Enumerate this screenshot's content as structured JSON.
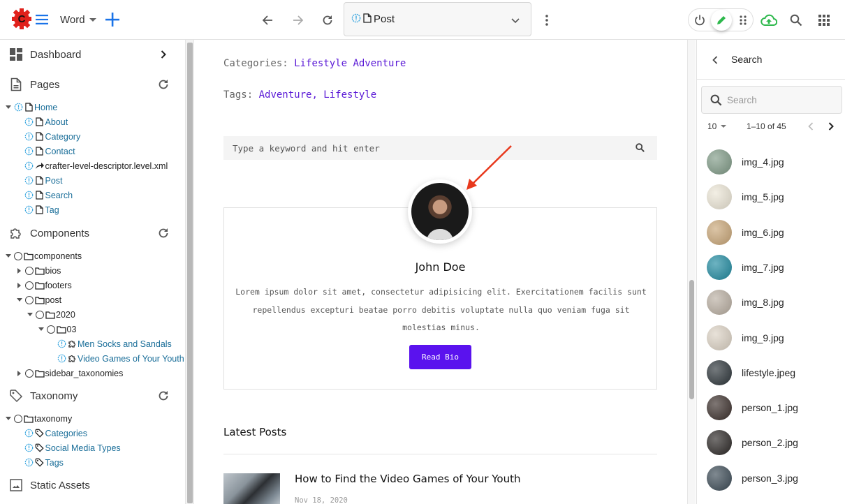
{
  "toolbar": {
    "site_name": "Word",
    "address_label": "Post",
    "icons": {
      "logo": "crafter-logo-icon",
      "menu": "hamburger-menu-icon",
      "add": "plus-icon",
      "back": "arrow-left-icon",
      "forward": "arrow-right-icon",
      "reload": "refresh-icon",
      "more": "more-vertical-icon",
      "preview_mode": "power-icon",
      "edit_mode": "pencil-icon",
      "move_mode": "drag-handle-icon",
      "publish": "cloud-upload-icon",
      "search": "search-icon",
      "apps": "apps-grid-icon"
    },
    "colors": {
      "brand_red": "#e0211b",
      "accent_blue": "#1a73e8",
      "edit_green": "#2db84c"
    }
  },
  "sidebar": {
    "dashboard": {
      "label": "Dashboard"
    },
    "pages": {
      "label": "Pages",
      "tree": [
        {
          "label": "Home",
          "level": 0,
          "expanded": true,
          "type": "page",
          "link": true
        },
        {
          "label": "About",
          "level": 1,
          "type": "page",
          "link": true
        },
        {
          "label": "Category",
          "level": 1,
          "type": "page",
          "link": true
        },
        {
          "label": "Contact",
          "level": 1,
          "type": "page",
          "link": true
        },
        {
          "label": "crafter-level-descriptor.level.xml",
          "level": 1,
          "type": "level-descriptor",
          "link": false
        },
        {
          "label": "Post",
          "level": 1,
          "type": "page",
          "link": true
        },
        {
          "label": "Search",
          "level": 1,
          "type": "page",
          "link": true
        },
        {
          "label": "Tag",
          "level": 1,
          "type": "page",
          "link": true
        }
      ]
    },
    "components": {
      "label": "Components",
      "tree": [
        {
          "label": "components",
          "level": 0,
          "expanded": true,
          "type": "folder"
        },
        {
          "label": "bios",
          "level": 1,
          "expanded": false,
          "type": "folder"
        },
        {
          "label": "footers",
          "level": 1,
          "expanded": false,
          "type": "folder"
        },
        {
          "label": "post",
          "level": 1,
          "expanded": true,
          "type": "folder"
        },
        {
          "label": "2020",
          "level": 2,
          "expanded": true,
          "type": "folder"
        },
        {
          "label": "03",
          "level": 3,
          "expanded": true,
          "type": "folder"
        },
        {
          "label": "Men Socks and Sandals",
          "level": 4,
          "type": "component",
          "link": true
        },
        {
          "label": "Video Games of Your Youth",
          "level": 4,
          "type": "component",
          "link": true
        },
        {
          "label": "sidebar_taxonomies",
          "level": 1,
          "expanded": false,
          "type": "folder"
        }
      ]
    },
    "taxonomy": {
      "label": "Taxonomy",
      "tree": [
        {
          "label": "taxonomy",
          "level": 0,
          "expanded": true,
          "type": "folder"
        },
        {
          "label": "Categories",
          "level": 1,
          "type": "taxonomy",
          "link": true
        },
        {
          "label": "Social Media Types",
          "level": 1,
          "type": "taxonomy",
          "link": true
        },
        {
          "label": "Tags",
          "level": 1,
          "type": "taxonomy",
          "link": true
        }
      ]
    },
    "static_assets": {
      "label": "Static Assets"
    }
  },
  "preview": {
    "categories_label": "Categories:",
    "categories_value": "Lifestyle Adventure",
    "tags_label": "Tags:",
    "tags_value": "Adventure, Lifestyle",
    "search_placeholder": "Type a keyword and hit enter",
    "bio": {
      "name": "John Doe",
      "text": "Lorem ipsum dolor sit amet, consectetur adipisicing elit. Exercitationem facilis sunt repellendus excepturi beatae porro debitis voluptate nulla quo veniam fuga sit molestias minus.",
      "button": "Read Bio"
    },
    "latest_posts_title": "Latest Posts",
    "posts": [
      {
        "title": "How to Find the Video Games of Your Youth",
        "date": "Nov 18, 2020"
      }
    ],
    "colors": {
      "link_purple": "#5a19d6",
      "button_purple": "#5a12ee",
      "annotation_arrow": "#e8381c"
    }
  },
  "right_panel": {
    "title": "Search",
    "search_placeholder": "Search",
    "page_size": "10",
    "range_text": "1–10 of 45",
    "assets": [
      {
        "name": "img_4.jpg",
        "color": "#7f9a86"
      },
      {
        "name": "img_5.jpg",
        "color": "#ece6d6"
      },
      {
        "name": "img_6.jpg",
        "color": "#c9a677"
      },
      {
        "name": "img_7.jpg",
        "color": "#1f8aa0"
      },
      {
        "name": "img_8.jpg",
        "color": "#b9aea1"
      },
      {
        "name": "img_9.jpg",
        "color": "#dcd2c4"
      },
      {
        "name": "lifestyle.jpeg",
        "color": "#2b3338"
      },
      {
        "name": "person_1.jpg",
        "color": "#3a2e2a"
      },
      {
        "name": "person_2.jpg",
        "color": "#2a2624"
      },
      {
        "name": "person_3.jpg",
        "color": "#3b4a55"
      }
    ]
  }
}
